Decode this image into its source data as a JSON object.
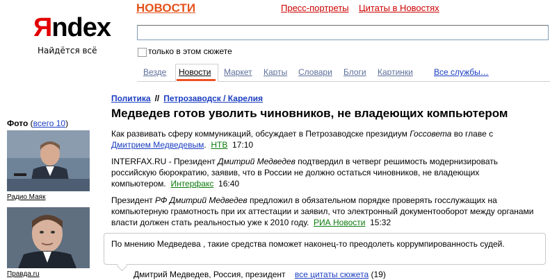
{
  "logo": {
    "first_letter": "Я",
    "rest": "ndex",
    "tagline": "Найдётся всё"
  },
  "header": {
    "section_title": "НОВОСТИ",
    "links": [
      "Пресс-портреты",
      "Цитаты в Новостях"
    ]
  },
  "search": {
    "value": "",
    "checkbox_label": "только в этом сюжете"
  },
  "tabs": {
    "items": [
      "Везде",
      "Новости",
      "Маркет",
      "Карты",
      "Словари",
      "Блоги",
      "Картинки"
    ],
    "all_services": "Все службы…",
    "active": "Новости"
  },
  "breadcrumb": {
    "first": "Политика",
    "separator": "//",
    "second": "Петрозаводск / Карелия"
  },
  "headline": "Медведев готов уволить чиновников, не владеющих компьютером",
  "articles": [
    {
      "text_a": "Как развивать сферу коммуникаций, обсуждает в Петрозаводске президиум ",
      "text_em": "Госсовета",
      "text_b": " во главе с ",
      "person_link": "Дмитрием Медведевым",
      "text_c": ".",
      "source": "НТВ",
      "time": "17:10"
    },
    {
      "text_a": "INTERFAX.RU - Президент ",
      "text_em": "Дмитрий Медведев",
      "text_b": " подтвердил в четверг решимость модернизировать российскую бюрократию, заявив, что в России не должно остаться чиновников, не владеющих компьютером.",
      "source": "Интерфакс",
      "time": "16:40"
    },
    {
      "text_a": "Президент ",
      "text_em": "РФ Дмитрий Медведев",
      "text_b": " предложил в обязательном порядке проверять госслужащих на компьютерную грамотность при их аттестации и заявил, что электронный документооборот между органами власти должен стать реальностью уже к 2010 году.",
      "source": "РИА Новости",
      "time": "15:32"
    }
  ],
  "photos": {
    "title": "Фото",
    "count_link": "всего 10",
    "items": [
      {
        "caption": "Радио Маяк"
      },
      {
        "caption": "Правда.ru"
      }
    ]
  },
  "quote": {
    "text": "По мнению Медведева , такие средства поможет наконец-то преодолеть коррумпированность судей.",
    "author": "Дмитрий Медведев, Россия, президент",
    "all_link": "все цитаты сюжета",
    "count": "(19)"
  }
}
